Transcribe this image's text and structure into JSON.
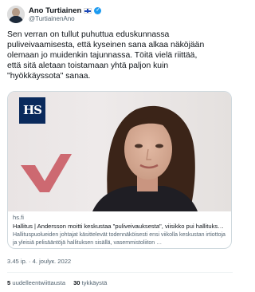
{
  "author": {
    "display_name": "Ano Turtiainen",
    "handle": "@TurtiainenAno",
    "flag": "finland-flag-icon",
    "verified_icon": "verified-badge-icon"
  },
  "tweet": {
    "text": "Sen verran on tullut puhuttua eduskunnassa\npuliveivaamisesta, että kyseinen sana alkaa näköjään\nolemaan jo muidenkin tajunnassa. Töitä vielä riittää,\nettä sitä aletaan toistamaan yhtä paljon kuin\n\"hyökkäyssota\" sanaa."
  },
  "card": {
    "logo_text": "HS",
    "domain": "hs.fi",
    "title": "Hallitus | Andersson moitti keskustaa \"puliveivauksesta\", viisikko pui hallituks…",
    "description": "Hallituspuolueiden johtajat käsittelevät todennäköisesti ensi viikolla keskustan irtiottoja ja yleisiä pelisääntöjä hallituksen sisällä, vasemmistoliiton …"
  },
  "meta": {
    "timestamp": "3.45 ip. · 4. joulук. 2022",
    "retweets_count": "5",
    "retweets_label": "uudelleentwiittausta",
    "likes_count": "30",
    "likes_label": "tykkäystä"
  },
  "colors": {
    "accent": "#1d9bf0",
    "hs_brand": "#0a2a5c",
    "text": "#0f1419",
    "muted": "#536471"
  }
}
